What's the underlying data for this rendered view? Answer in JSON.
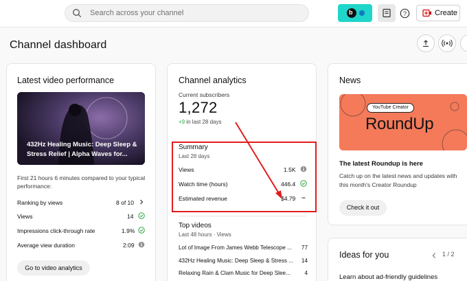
{
  "topbar": {
    "search_placeholder": "Search across your channel",
    "create_label": "Create",
    "live_badge": "b"
  },
  "page": {
    "title": "Channel dashboard"
  },
  "latest_video": {
    "title": "Latest video performance",
    "thumbnail_title": "432Hz Healing Music: Deep Sleep & Stress Relief | Alpha Waves for...",
    "thumbnail_overlay_text": "432Hz HEALING MUSIC",
    "description": "First 21 hours 6 minutes compared to your typical performance:",
    "metrics": [
      {
        "label": "Ranking by views",
        "value": "8 of 10",
        "indicator": "chevron-right-icon"
      },
      {
        "label": "Views",
        "value": "14",
        "indicator": "check-circle-icon"
      },
      {
        "label": "Impressions click-through rate",
        "value": "1.9%",
        "indicator": "check-circle-icon"
      },
      {
        "label": "Average view duration",
        "value": "2:09",
        "indicator": "info-circle-icon"
      }
    ],
    "button_label": "Go to video analytics"
  },
  "analytics": {
    "title": "Channel analytics",
    "subscribers_label": "Current subscribers",
    "subscribers_value": "1,272",
    "subscribers_change": "+9",
    "subscribers_change_suffix": " in last 28 days",
    "summary_title": "Summary",
    "summary_period": "Last 28 days",
    "summary_rows": [
      {
        "label": "Views",
        "value": "1.5K",
        "indicator": "info-circle-icon"
      },
      {
        "label": "Watch time (hours)",
        "value": "446.4",
        "indicator": "check-circle-icon"
      },
      {
        "label": "Estimated revenue",
        "value": "$4.79",
        "indicator": "dash-icon"
      }
    ],
    "top_videos_title": "Top videos",
    "top_videos_period": "Last 48 hours · Views",
    "top_videos": [
      {
        "name": "Lot of Image From James Webb Telescope ...",
        "views": "77"
      },
      {
        "name": "432Hz Healing Music: Deep Sleep & Stress ...",
        "views": "14"
      },
      {
        "name": "Relaxing Rain & Clam Music for Deep Slee...",
        "views": "4"
      }
    ]
  },
  "news": {
    "title": "News",
    "image_pill": "YouTube Creator",
    "image_heading": "RoundUp",
    "headline": "The latest Roundup is here",
    "body": "Catch up on the latest news and updates with this month's Creator Roundup",
    "button_label": "Check it out"
  },
  "ideas": {
    "title": "Ideas for you",
    "pager": "1 / 2",
    "item": "Learn about ad-friendly guidelines"
  },
  "colors": {
    "accent_teal": "#20d5c9",
    "highlight_red": "#e21b1b",
    "success_green": "#2ba640",
    "news_orange": "#f47a5a"
  }
}
